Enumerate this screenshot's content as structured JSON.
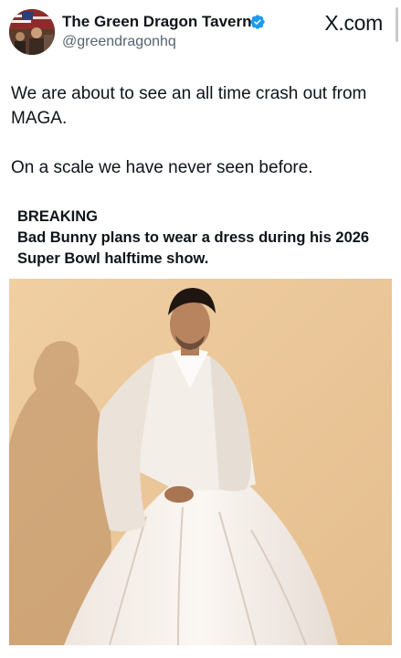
{
  "post": {
    "author": {
      "display_name": "The Green Dragon Tavern",
      "handle": "@greendragonhq",
      "verified": true,
      "verified_color": "#1d9bf0"
    },
    "brand": "X.com",
    "text_lines": [
      "We are about to see an all time crash out from MAGA.",
      "On a scale we have never seen before."
    ]
  },
  "card": {
    "label": "BREAKING",
    "headline": "Bad Bunny plans to wear a dress during his 2026 Super Bowl halftime show."
  },
  "colors": {
    "text": "#0f1419",
    "secondary_text": "#536471",
    "photo_background": "#e9c79b"
  },
  "icons": {
    "verified": "verified-badge-icon"
  }
}
